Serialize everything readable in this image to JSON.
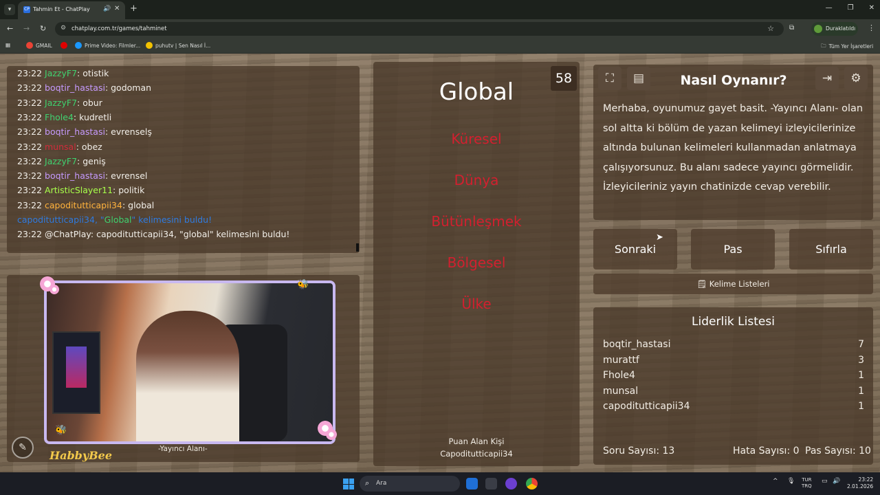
{
  "browser": {
    "tab_title": "Tahmin Et - ChatPlay",
    "tab_favicon": "CP",
    "url": "chatplay.com.tr/games/tahminet",
    "profile_label": "Duraklatıldı",
    "bookmarks": [
      {
        "label": "GMAIL",
        "color": "#ea4335"
      },
      {
        "label": "",
        "color": "#e00000"
      },
      {
        "label": "Prime Video: Filmler...",
        "color": "#1a98ff"
      },
      {
        "label": "puhutv | Sen Nasıl İ...",
        "color": "#f2c200"
      }
    ],
    "all_bookmarks": "Tüm Yer İşaretleri"
  },
  "chat": {
    "lines": [
      {
        "time": "23:22",
        "user": "JazzyF7",
        "color": "#3fd16f",
        "msg": ": otistik"
      },
      {
        "time": "23:22",
        "user": "boqtir_hastasi",
        "color": "#c79bff",
        "msg": ": godoman"
      },
      {
        "time": "23:22",
        "user": "JazzyF7",
        "color": "#3fd16f",
        "msg": ": obur"
      },
      {
        "time": "23:22",
        "user": "Fhole4",
        "color": "#3fd16f",
        "msg": ": kudretli"
      },
      {
        "time": "23:22",
        "user": "boqtir_hastasi",
        "color": "#c79bff",
        "msg": ": evrenselş"
      },
      {
        "time": "23:22",
        "user": "munsal",
        "color": "#d12b3a",
        "msg": ": obez"
      },
      {
        "time": "23:22",
        "user": "JazzyF7",
        "color": "#3fd16f",
        "msg": ": geniş"
      },
      {
        "time": "23:22",
        "user": "boqtir_hastasi",
        "color": "#c79bff",
        "msg": ": evrensel"
      },
      {
        "time": "23:22",
        "user": "ArtisticSlayer11",
        "color": "#a8ff4a",
        "msg": ": politik"
      },
      {
        "time": "23:22",
        "user": "capoditutticapii34",
        "color": "#ffb23c",
        "msg": ": global"
      }
    ],
    "system_line": {
      "user": "capoditutticapii34",
      "word": "Global",
      "rest": " kelimesini buldu!"
    },
    "bot_line": {
      "time": "23:22",
      "text": "@ChatPlay: capoditutticapii34, \"global\" kelimesini buldu!"
    }
  },
  "stream": {
    "label": "-Yayıncı Alanı-",
    "logo": "HabbyBee"
  },
  "game": {
    "timer": "58",
    "word": "Global",
    "forbidden": [
      "Küresel",
      "Dünya",
      "Bütünleşmek",
      "Bölgesel",
      "Ülke"
    ],
    "scorer_label": "Puan Alan Kişi",
    "scorer": "Capoditutticapii34"
  },
  "howto": {
    "title": "Nasıl Oynanır?",
    "text": "Merhaba, oyunumuz gayet basit. -Yayıncı Alanı- olan sol altta ki bölüm de yazan kelimeyi izleyicilerinize altında bulunan kelimeleri kullanmadan anlatmaya çalışıyorsunuz. Bu alanı sadece yayıncı görmelidir. İzleyicileriniz yayın chatinizde cevap verebilir."
  },
  "controls": {
    "next": "Sonraki",
    "pass": "Pas",
    "reset": "Sıfırla",
    "word_lists": "Kelime Listeleri"
  },
  "leaderboard": {
    "title": "Liderlik Listesi",
    "rows": [
      {
        "name": "boqtir_hastasi",
        "score": "7"
      },
      {
        "name": "murattf",
        "score": "3"
      },
      {
        "name": "Fhole4",
        "score": "1"
      },
      {
        "name": "munsal",
        "score": "1"
      },
      {
        "name": "capoditutticapii34",
        "score": "1"
      }
    ],
    "question_count": "Soru Sayısı: 13",
    "error_count": "Hata Sayısı: 0",
    "pass_count": "Pas Sayısı: 10"
  },
  "taskbar": {
    "search": "Ara",
    "lang_top": "TUR",
    "lang_bottom": "TRQ",
    "time": "23:22",
    "date": "2.01.2026"
  }
}
